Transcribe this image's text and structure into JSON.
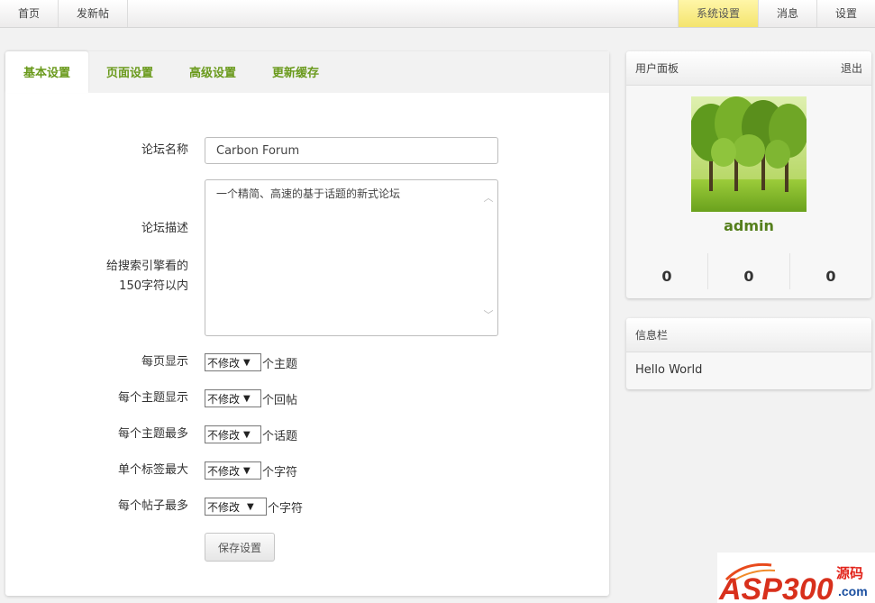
{
  "topbar": {
    "left": [
      "首页",
      "发新帖"
    ],
    "right": [
      {
        "label": "系统设置",
        "active": true
      },
      {
        "label": "消息",
        "active": false
      },
      {
        "label": "设置",
        "active": false
      }
    ]
  },
  "tabs": [
    "基本设置",
    "页面设置",
    "高级设置",
    "更新缓存"
  ],
  "form": {
    "forum_name_label": "论坛名称",
    "forum_name_value": "Carbon Forum",
    "forum_desc_label": "论坛描述",
    "forum_desc_hint_1": "给搜索引擎看的",
    "forum_desc_hint_2": "150字符以内",
    "forum_desc_value": "一个精简、高速的基于话题的新式论坛",
    "rows": [
      {
        "label": "每页显示",
        "select": "不修改",
        "unit": "个主题"
      },
      {
        "label": "每个主题显示",
        "select": "不修改",
        "unit": "个回帖"
      },
      {
        "label": "每个主题最多",
        "select": "不修改",
        "unit": "个话题"
      },
      {
        "label": "单个标签最大",
        "select": "不修改",
        "unit": "个字符"
      },
      {
        "label": "每个帖子最多",
        "select": "不修改",
        "unit": "个字符"
      }
    ],
    "save_label": "保存设置"
  },
  "user_panel": {
    "title": "用户面板",
    "logout": "退出",
    "username": "admin",
    "stats": [
      "0",
      "0",
      "0"
    ]
  },
  "info_panel": {
    "title": "信息栏",
    "content": "Hello World"
  },
  "watermark": {
    "brand": "ASP300",
    "suffix_1": "源码",
    "suffix_2": ".com"
  }
}
